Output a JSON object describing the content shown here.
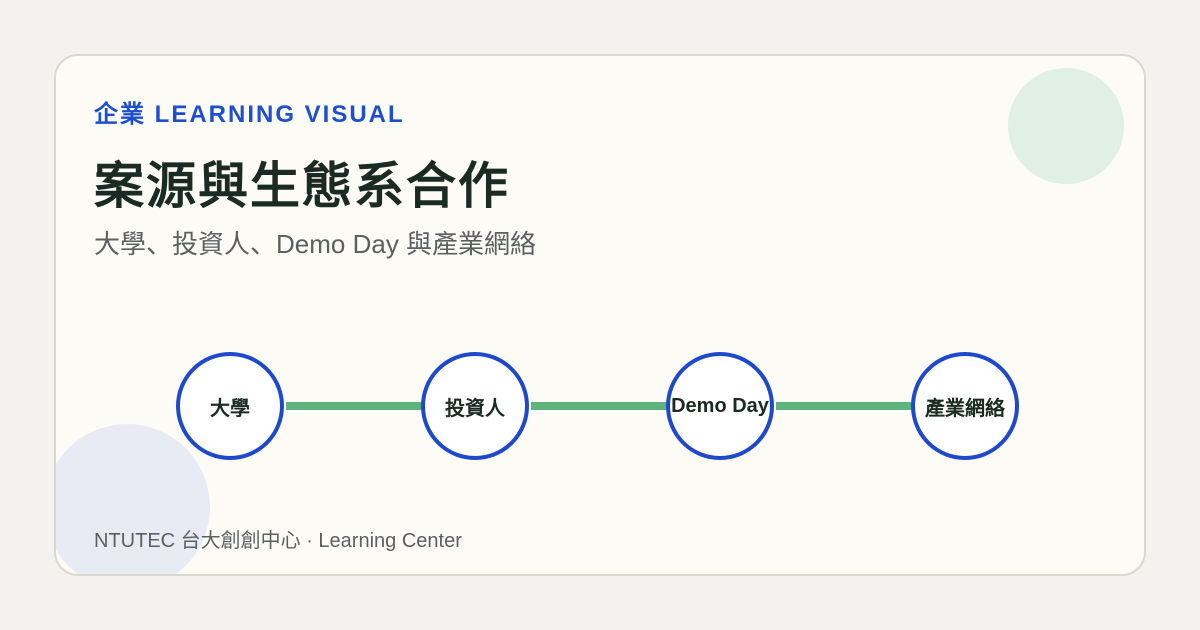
{
  "header": {
    "eyebrow": "企業 LEARNING VISUAL",
    "title": "案源與生態系合作",
    "subtitle": "大學、投資人、Demo Day 與產業網絡"
  },
  "flow": {
    "nodes": [
      {
        "label": "大學"
      },
      {
        "label": "投資人"
      },
      {
        "label": "Demo Day"
      },
      {
        "label": "產業網絡"
      }
    ]
  },
  "footer": {
    "text": "NTUTEC 台大創創中心 · Learning Center"
  },
  "colors": {
    "accent_blue": "#1d4fd0",
    "node_border": "#1f49cc",
    "connector_green": "#5fb37c",
    "title_dark": "#1c2a24",
    "muted_text": "#5b6160",
    "card_background": "#fcfbf6",
    "page_background": "#f4f2ee",
    "decor_green": "#e0f0e2",
    "decor_blue": "#e8ebf3"
  }
}
